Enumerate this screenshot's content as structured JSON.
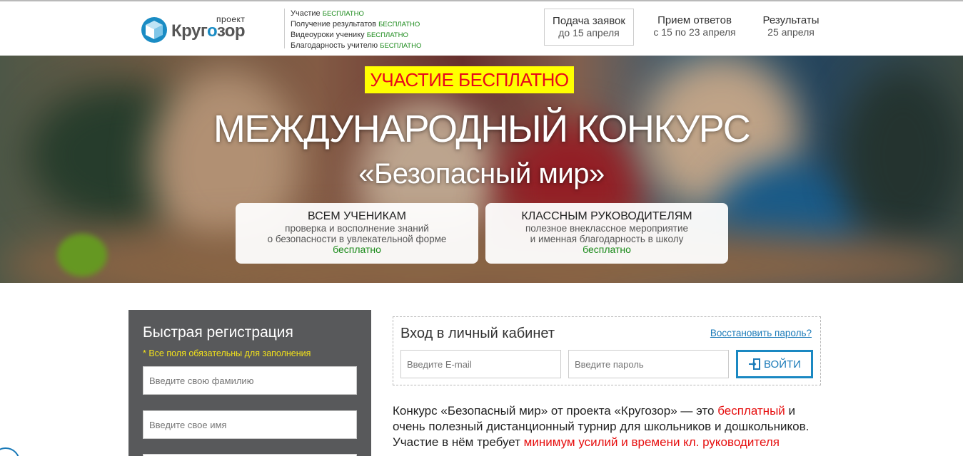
{
  "header": {
    "logo_small": "проект",
    "logo_big_1": "Круг",
    "logo_big_o": "о",
    "logo_big_2": "зор",
    "features": [
      {
        "text": "Участие ",
        "free": "бесплатно"
      },
      {
        "text": "Получение результатов ",
        "free": "бесплатно"
      },
      {
        "text": "Видеоуроки ученику ",
        "free": "бесплатно"
      },
      {
        "text": "Благодарность учителю ",
        "free": "бесплатно"
      }
    ],
    "steps": [
      {
        "title": "Подача заявок",
        "date": "до 15 апреля"
      },
      {
        "title": "Прием ответов",
        "date": "с 15 по 23 апреля"
      },
      {
        "title": "Результаты",
        "date": "25 апреля"
      }
    ]
  },
  "hero": {
    "badge": "УЧАСТИЕ БЕСПЛАТНО",
    "title": "МЕЖДУНАРОДНЫЙ КОНКУРС",
    "subtitle": "«Безопасный мир»",
    "cards": [
      {
        "title": "ВСЕМ УЧЕНИКАМ",
        "line1": "проверка и восполнение знаний",
        "line2": "о безопасности в увлекательной форме",
        "free": "бесплатно"
      },
      {
        "title": "КЛАССНЫМ РУКОВОДИТЕЛЯМ",
        "line1": "полезное внеклассное мероприятие",
        "line2": "и именная благодарность в школу",
        "free": "бесплатно"
      }
    ]
  },
  "registration": {
    "title": "Быстрая регистрация",
    "note": "* Все поля обязательны для заполнения",
    "surname_placeholder": "Введите свою фамилию",
    "name_placeholder": "Введите свое имя"
  },
  "login": {
    "title": "Вход в личный кабинет",
    "restore": "Восстановить пароль?",
    "email_placeholder": "Введите E-mail",
    "password_placeholder": "Введите пароль",
    "button": "ВОЙТИ"
  },
  "description": {
    "p1": "Конкурс «Безопасный мир» от проекта «Кругозор» — это ",
    "p1_red": "бесплатный",
    "p2": " и очень полезный дистанционный турнир для школьников и дошкольников. Участие в нём требует ",
    "p2_red": "минимум усилий и времени кл. руководителя"
  },
  "colors": {
    "accent_blue": "#1a88c2",
    "free_green": "#1a8a1a",
    "badge_yellow": "#ffff00",
    "badge_red": "#e8081b",
    "panel_gray": "#58595b"
  }
}
